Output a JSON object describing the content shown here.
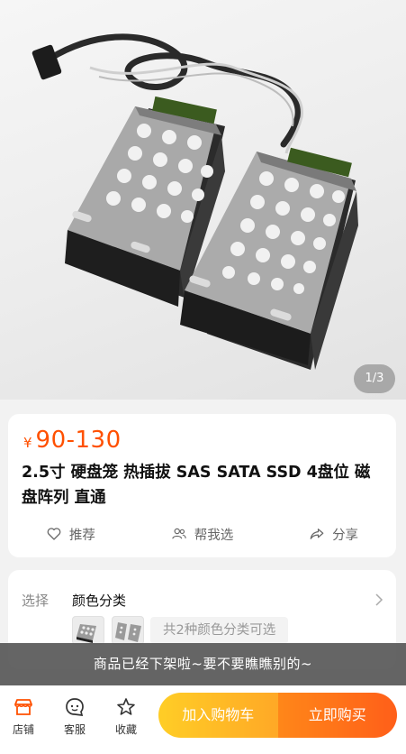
{
  "gallery": {
    "counter": "1/3"
  },
  "product": {
    "price_currency": "¥",
    "price_range": "90-130",
    "title": "2.5寸 硬盘笼 热插拔 SAS SATA SSD 4盘位 磁盘阵列 直通",
    "actions": [
      {
        "label": "推荐",
        "icon": "heart-icon"
      },
      {
        "label": "帮我选",
        "icon": "people-icon"
      },
      {
        "label": "分享",
        "icon": "share-icon"
      }
    ]
  },
  "spec": {
    "label": "选择",
    "value": "颜色分类",
    "variant_summary": "共2种颜色分类可选",
    "thumb_count": 2
  },
  "toast": {
    "message": "商品已经下架啦~要不要瞧瞧别的~"
  },
  "bottom_bar": {
    "tabs": [
      {
        "label": "店铺",
        "icon": "shop-icon"
      },
      {
        "label": "客服",
        "icon": "service-icon"
      },
      {
        "label": "收藏",
        "icon": "star-icon"
      }
    ],
    "add_to_cart": "加入购物车",
    "buy_now": "立即购买"
  },
  "colors": {
    "accent": "#ff5000",
    "cart_button": "#ffb400",
    "buy_button": "#ff6200"
  }
}
